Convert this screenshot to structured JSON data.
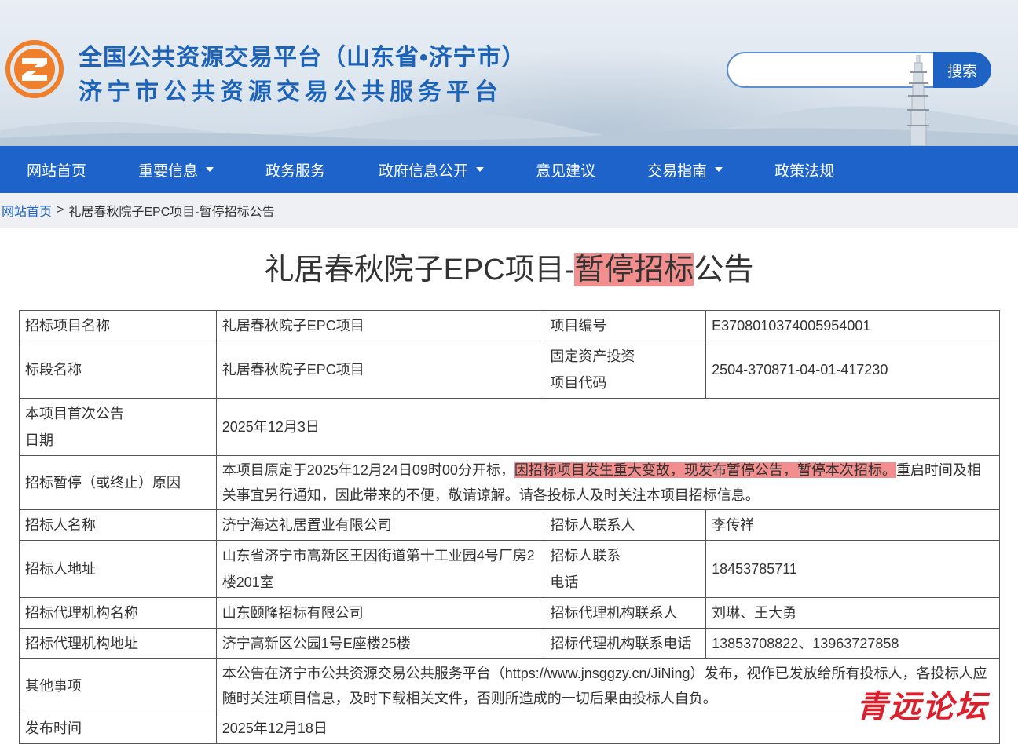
{
  "header": {
    "title_line1": "全国公共资源交易平台（山东省•济宁市）",
    "title_line2": "济宁市公共资源交易公共服务平台",
    "search_placeholder": "",
    "search_button": "搜索"
  },
  "nav": {
    "items": [
      {
        "label": "网站首页",
        "dropdown": false
      },
      {
        "label": "重要信息",
        "dropdown": true
      },
      {
        "label": "政务服务",
        "dropdown": false
      },
      {
        "label": "政府信息公开",
        "dropdown": true
      },
      {
        "label": "意见建议",
        "dropdown": false
      },
      {
        "label": "交易指南",
        "dropdown": true
      },
      {
        "label": "政策法规",
        "dropdown": false
      }
    ]
  },
  "breadcrumb": {
    "home": "网站首页",
    "separator": ">",
    "current": "礼居春秋院子EPC项目-暂停招标公告"
  },
  "article": {
    "title_before": "礼居春秋院子EPC项目-",
    "title_highlight": "暂停招标",
    "title_after": "公告"
  },
  "table": {
    "project_name_label": "招标项目名称",
    "project_name": "礼居春秋院子EPC项目",
    "project_no_label": "项目编号",
    "project_no": "E3708010374005954001",
    "section_name_label": "标段名称",
    "section_name": "礼居春秋院子EPC项目",
    "asset_code_label_1": "固定资产投资",
    "asset_code_label_2": "项目代码",
    "asset_code": "2504-370871-04-01-417230",
    "first_notice_label_1": "本项目首次公告",
    "first_notice_label_2": "日期",
    "first_notice_date": "2025年12月3日",
    "reason_label": "招标暂停（或终止）原因",
    "reason_before": "本项目原定于2025年12月24日09时00分开标，",
    "reason_highlight": "因招标项目发生重大变故，现发布暂停公告，暂停本次招标。",
    "reason_after": "重启时间及相关事宜另行通知，因此带来的不便，敬请谅解。请各投标人及时关注本项目招标信息。",
    "tenderer_label": "招标人名称",
    "tenderer": "济宁海达礼居置业有限公司",
    "tenderer_contact_label": "招标人联系人",
    "tenderer_contact": "李传祥",
    "tenderer_addr_label": "招标人地址",
    "tenderer_addr": "山东省济宁市高新区王因街道第十工业园4号厂房2楼201室",
    "tenderer_phone_label_1": "招标人联系",
    "tenderer_phone_label_2": "电话",
    "tenderer_phone": "18453785711",
    "agency_label": "招标代理机构名称",
    "agency": "山东颐隆招标有限公司",
    "agency_contact_label": "招标代理机构联系人",
    "agency_contact": "刘琳、王大勇",
    "agency_addr_label": "招标代理机构地址",
    "agency_addr": "济宁高新区公园1号E座楼25楼",
    "agency_phone_label": "招标代理机构联系电话",
    "agency_phone": "13853708822、13963727858",
    "other_label": "其他事项",
    "other": "本公告在济宁市公共资源交易公共服务平台（https://www.jnsggzy.cn/JiNing）发布，视作已发放给所有投标人，各投标人应随时关注项目信息，及时下载相关文件，否则所造成的一切后果由投标人自负。",
    "publish_label": "发布时间",
    "publish_date": "2025年12月18日"
  },
  "watermark": "青远论坛",
  "colors": {
    "nav_bg": "#1d63c9",
    "title_blue": "#1d63b7",
    "highlight": "#f28e8e",
    "logo_orange": "#ef7f2b",
    "watermark_red": "#d9202c"
  },
  "icons": {
    "logo": "orange-circle-z-logo",
    "dropdown": "caret-down-icon",
    "pagoda": "pagoda-illustration"
  }
}
